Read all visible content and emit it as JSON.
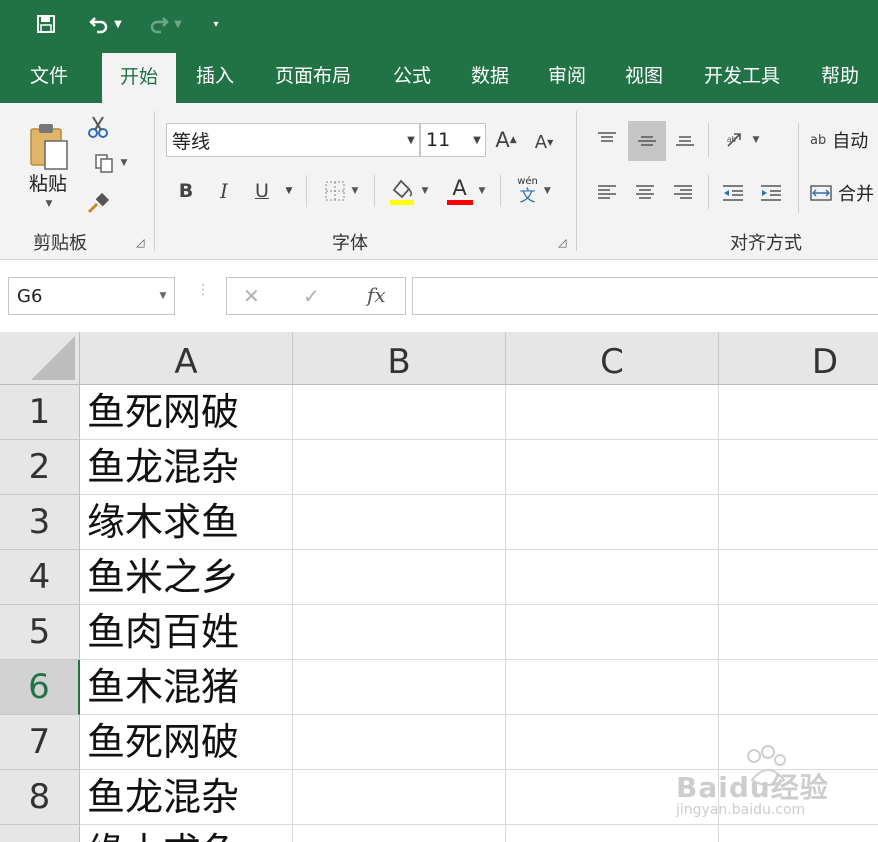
{
  "quick_access": {
    "save_icon": "save-icon",
    "undo_icon": "undo-icon",
    "redo_icon": "redo-icon",
    "customize_icon": "customize-qat-icon"
  },
  "tabs": [
    {
      "label": "文件",
      "active": false
    },
    {
      "label": "开始",
      "active": true
    },
    {
      "label": "插入",
      "active": false
    },
    {
      "label": "页面布局",
      "active": false
    },
    {
      "label": "公式",
      "active": false
    },
    {
      "label": "数据",
      "active": false
    },
    {
      "label": "审阅",
      "active": false
    },
    {
      "label": "视图",
      "active": false
    },
    {
      "label": "开发工具",
      "active": false
    },
    {
      "label": "帮助",
      "active": false
    }
  ],
  "ribbon": {
    "clipboard": {
      "label": "剪贴板",
      "paste_label": "粘贴"
    },
    "font": {
      "label": "字体",
      "font_name": "等线",
      "font_size": "11",
      "bold": "B",
      "italic": "I",
      "underline": "U",
      "font_color_glyph": "A",
      "grow_font": "A",
      "shrink_font": "A",
      "phonetic_top": "wén",
      "phonetic_bottom": "文"
    },
    "alignment": {
      "label": "对齐方式",
      "wrap_text_label": "自动",
      "merge_label": "合并",
      "wrap_glyph": "ab"
    }
  },
  "formula_bar": {
    "name_box": "G6",
    "cancel": "✕",
    "enter": "✓",
    "fx": "fx",
    "value": ""
  },
  "sheet": {
    "columns": [
      "A",
      "B",
      "C",
      "D"
    ],
    "rows": [
      "1",
      "2",
      "3",
      "4",
      "5",
      "6",
      "7",
      "8",
      ""
    ],
    "selected_row": "6",
    "column_a_values": [
      "鱼死网破",
      "鱼龙混杂",
      "缘木求鱼",
      "鱼米之乡",
      "鱼肉百姓",
      "鱼木混猪",
      "鱼死网破",
      "鱼龙混杂",
      "缘木求鱼"
    ]
  },
  "colors": {
    "accent": "#217346",
    "highlight_yellow": "#ffff00",
    "font_red": "#ff0000"
  },
  "watermark": {
    "brand": "Baidu经验",
    "url": "jingyan.baidu.com"
  }
}
